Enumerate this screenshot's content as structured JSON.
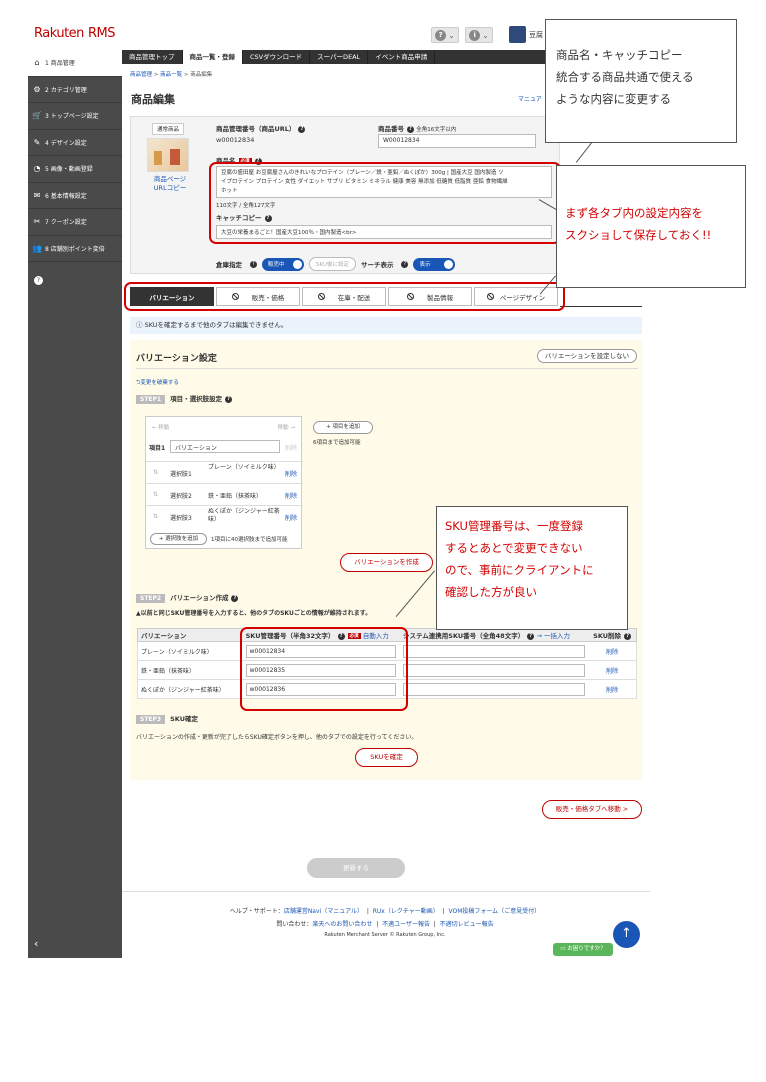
{
  "header": {
    "logo_main": "Rakuten",
    "logo_sub": "RMS",
    "help_icon": "?",
    "user_icon": "i",
    "shop_name": "豆腐"
  },
  "sidebar": {
    "items": [
      {
        "icon": "⌂",
        "label": "1 商品管理"
      },
      {
        "icon": "⚙",
        "label": "2 カテゴリ管理"
      },
      {
        "icon": "🛒",
        "label": "3 トップページ設定"
      },
      {
        "icon": "✎",
        "label": "4 デザイン設定"
      },
      {
        "icon": "◔",
        "label": "5 画像・動画登録"
      },
      {
        "icon": "✉",
        "label": "6 基本情報設定"
      },
      {
        "icon": "✂",
        "label": "7 クーポン設定"
      },
      {
        "icon": "👥",
        "label": "8 店舗別ポイント変倍"
      }
    ],
    "circle": "?",
    "collapse": "‹"
  },
  "tabbar": [
    "商品管理トップ",
    "商品一覧・登録",
    "CSVダウンロード",
    "スーパーDEAL",
    "イベント商品申請"
  ],
  "breadcrumb": {
    "a": "商品管理",
    "sep": ">",
    "b": "商品一覧",
    "c": "商品編集"
  },
  "page": {
    "title": "商品編集",
    "manual": "マニュア"
  },
  "info": {
    "thumb_label": "通常商品",
    "thumb_link_1": "商品ページ",
    "thumb_link_2": "URLコピー",
    "mgmt_label": "商品管理番号（商品URL）",
    "mgmt_value": "w00012834",
    "number_label": "商品番号",
    "number_hint": "全角16文字以内",
    "number_value": "W00012834",
    "name_label": "商品名",
    "required": "必須",
    "name_line1": "豆腐の盛田屋 お豆腐屋さんのきれいなプロテイン（プレーン／鉄・亜鉛／ぬくぽか）300g | 国産大豆 国内製造 ソ",
    "name_line2": "イプロテイン プロテイン 女性 ダイエット サプリ ビタミン ミネラル 健康 美容 無添加 低糖質 低脂質 亜鉛 食物繊維",
    "name_line3": "ホット",
    "name_count": "110文字 / 全角127文字",
    "catch_label": "キャッチコピー",
    "catch_value": "大豆の栄養まるごと！国産大豆100％・国内製造<br>",
    "warehouse_label": "倉庫指定",
    "on_sale": "販売中",
    "sku_after": "SKU後に設定",
    "search_label": "サーチ表示",
    "display": "表示"
  },
  "product_tabs": [
    "バリエーション",
    "販売・価格",
    "在庫・配送",
    "製品情報",
    "ページデザイン"
  ],
  "notice": "SKUを確定するまで他のタブは編集できません。",
  "variation": {
    "title": "バリエーション設定",
    "not_set_btn": "バリエーションを設定しない",
    "undo": "変更を破棄する",
    "step1_tag": "STEP1",
    "step1_label": "項目・選択肢設定",
    "move_left": "← 移動",
    "move_right": "移動 →",
    "item1_label": "項目1",
    "item1_value": "バリエーション",
    "delete": "削除",
    "add_item_btn": "+ 項目を追加",
    "add_item_note": "6項目まで追加可能",
    "options": [
      {
        "label": "選択肢1",
        "value": "プレーン（ソイミルク味）"
      },
      {
        "label": "選択肢2",
        "value": "鉄・亜鉛（抹茶味）"
      },
      {
        "label": "選択肢3",
        "value": "ぬくぽか（ジンジャー紅茶味）"
      }
    ],
    "add_option_btn": "+ 選択肢を追加",
    "add_option_note": "1項目に40選択肢まで追加可能",
    "create_btn": "バリエーションを作成",
    "step2_tag": "STEP2",
    "step2_label": "バリエーション作成",
    "step2_warning": "▲以前と同じSKU管理番号を入力すると、他のタブのSKUごとの情報が維持されます。",
    "col_variation": "バリエーション",
    "col_sku": "SKU管理番号（半角32文字）",
    "auto_input": "自動入力",
    "col_system": "システム連携用SKU番号（全角48文字）",
    "bulk_input": "一括入力",
    "col_delete": "SKU削除",
    "rows": [
      {
        "name": "プレーン（ソイミルク味）",
        "sku": "w00012834"
      },
      {
        "name": "鉄・亜鉛（抹茶味）",
        "sku": "w00012835"
      },
      {
        "name": "ぬくぽか（ジンジャー紅茶味）",
        "sku": "w00012836"
      }
    ],
    "step3_tag": "STEP3",
    "step3_label": "SKU確定",
    "step3_desc": "バリエーションの作成・更新が完了したらSKU確定ボタンを押し、他のタブでの設定を行ってください。",
    "confirm_btn": "SKUを確定",
    "next_tab_btn": "販売・価格タブへ移動 >"
  },
  "update_btn": "更新する",
  "footer": {
    "help_prefix": "ヘルプ・サポート：",
    "help_links": [
      "店舗運営Navi（マニュアル）",
      "RUx（レクチャー動画）",
      "VOM投稿フォーム（ご意見受付）"
    ],
    "contact_prefix": "問い合わせ：",
    "contact_links": [
      "楽天へのお問い合わせ",
      "不適ユーザー報告",
      "不適切レビュー報告"
    ],
    "sep": "|",
    "copyright": "Rakuten Merchant Server © Rakuten Group, Inc."
  },
  "fab_up": "↑",
  "help_chip": "お困りですか？",
  "callouts": {
    "c1": [
      "商品名・キャッチコピー",
      "統合する商品共通で使える",
      "ような内容に変更する"
    ],
    "c2": [
      "まず各タブ内の設定内容を",
      "スクショして保存しておく!!"
    ],
    "c3": [
      "SKU管理番号は、一度登録",
      "するとあとで変更できない",
      "ので、事前にクライアントに",
      "確認した方が良い"
    ]
  },
  "colors": {
    "accent": "#bf0000",
    "link": "#1a56b5",
    "sidebar": "#4a4a4a",
    "annotation_red": "#d40000",
    "section_bg": "#fffbe8"
  }
}
